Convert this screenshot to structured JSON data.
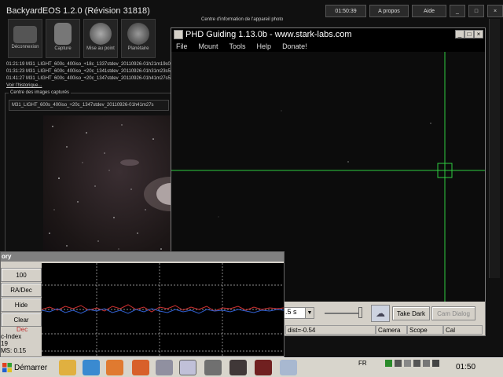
{
  "backyard": {
    "title": "BackyardEOS 1.2.0 (Révision 31818)",
    "time": "01:50:39",
    "about": "A propos",
    "help": "Aide",
    "modes": [
      {
        "label": "Déconnexion"
      },
      {
        "label": "Capture"
      },
      {
        "label": "Mise au point"
      },
      {
        "label": "Planétaire"
      }
    ],
    "log": [
      "01:21:19  M31_LIGHT_600s_400iso_+18c_1337stdev_20110926-01h21m19s0",
      "01:31:23  M31_LIGHT_600s_400iso_+20c_1341stdev_20110926-01h31m23s5",
      "01:41:27  M31_LIGHT_600s_400iso_+20c_1347stdev_20110926-01h41m27s5"
    ],
    "history_link": "Voir l'historique...",
    "captured_title": "Centre des images capturés",
    "captured_file": "M31_LIGHT_600s_400iso_+20c_1347stdev_20110926-01h41m27s",
    "info_panel": "Centre d'information de l'appareil photo"
  },
  "phd": {
    "title": "PHD Guiding 1.13.0b  -  www.stark-labs.com",
    "menu": [
      "File",
      "Mount",
      "Tools",
      "Help",
      "Donate!"
    ],
    "exposure": ".5 s",
    "take_dark": "Take Dark",
    "cam_dialog": "Cam Dialog",
    "status": {
      "dist": "dist=-0.54",
      "camera": "Camera",
      "scope": "Scope",
      "cal": "Cal"
    },
    "colors": {
      "crosshair": "#2ecc40",
      "box": "#2ecc40"
    }
  },
  "history": {
    "title": "ory",
    "btn_scale": "100",
    "btn_mode": "RA/Dec",
    "btn_hide": "Hide",
    "btn_clear": "Clear",
    "label_dec": "Dec",
    "label_index": "c-Index",
    "label_value": "19",
    "label_rms": "MS: 0.15",
    "colors": {
      "ra": "#d03030",
      "dec": "#3060d0",
      "grid": "#bbbbbb"
    }
  },
  "taskbar": {
    "start": "Démarrer",
    "lang": "FR",
    "clock": "01:50"
  }
}
